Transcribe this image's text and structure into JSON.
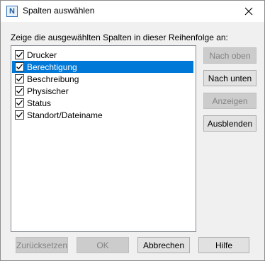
{
  "window": {
    "title": "Spalten auswählen",
    "app_icon_letter": "N"
  },
  "instruction": "Zeige die ausgewählten Spalten in dieser Reihenfolge an:",
  "columns": [
    {
      "label": "Drucker",
      "checked": true,
      "selected": false
    },
    {
      "label": "Berechtigung",
      "checked": true,
      "selected": true
    },
    {
      "label": "Beschreibung",
      "checked": true,
      "selected": false
    },
    {
      "label": "Physischer",
      "checked": true,
      "selected": false
    },
    {
      "label": "Status",
      "checked": true,
      "selected": false
    },
    {
      "label": "Standort/Dateiname",
      "checked": true,
      "selected": false
    }
  ],
  "side_buttons": {
    "move_up": {
      "label": "Nach oben",
      "enabled": false
    },
    "move_down": {
      "label": "Nach unten",
      "enabled": true
    },
    "show": {
      "label": "Anzeigen",
      "enabled": false
    },
    "hide": {
      "label": "Ausblenden",
      "enabled": true
    }
  },
  "bottom_buttons": {
    "reset": {
      "label": "Zurücksetzen",
      "enabled": false
    },
    "ok": {
      "label": "OK",
      "enabled": false
    },
    "cancel": {
      "label": "Abbrechen",
      "enabled": true
    },
    "help": {
      "label": "Hilfe",
      "enabled": true
    }
  },
  "colors": {
    "selection": "#0078d7",
    "dialog_bg": "#f0f0f0",
    "button_bg": "#e1e1e1"
  }
}
